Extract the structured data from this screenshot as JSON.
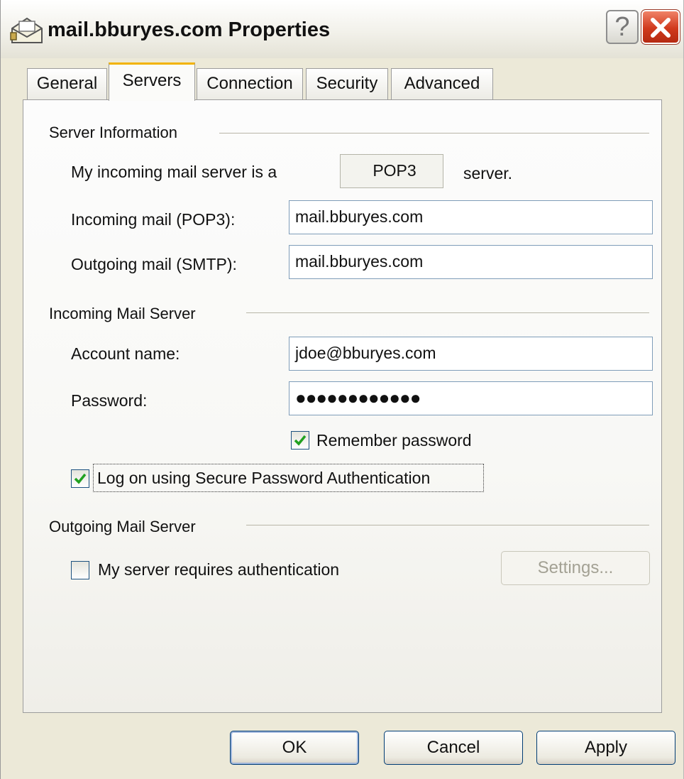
{
  "window": {
    "title": "mail.bburyes.com Properties",
    "icon": "mail-account-icon",
    "help_glyph": "?",
    "close_icon": "close-icon"
  },
  "tabs": [
    {
      "label": "General",
      "active": false
    },
    {
      "label": "Servers",
      "active": true
    },
    {
      "label": "Connection",
      "active": false
    },
    {
      "label": "Security",
      "active": false
    },
    {
      "label": "Advanced",
      "active": false
    }
  ],
  "server_info": {
    "group_label": "Server Information",
    "incoming_type_label_pre": "My incoming mail server is a",
    "incoming_type_value": "POP3",
    "incoming_type_label_post": "server.",
    "incoming_label": "Incoming mail (POP3):",
    "incoming_value": "mail.bburyes.com",
    "outgoing_label": "Outgoing mail (SMTP):",
    "outgoing_value": "mail.bburyes.com"
  },
  "incoming_server": {
    "group_label": "Incoming Mail Server",
    "account_label": "Account name:",
    "account_value": "jdoe@bburyes.com",
    "password_label": "Password:",
    "password_value": "●●●●●●●●●●●●",
    "remember_label": "Remember password",
    "remember_checked": true,
    "spa_label": "Log on using Secure Password Authentication",
    "spa_checked": true
  },
  "outgoing_server": {
    "group_label": "Outgoing Mail Server",
    "auth_label": "My server requires authentication",
    "auth_checked": false,
    "settings_label": "Settings..."
  },
  "buttons": {
    "ok": "OK",
    "cancel": "Cancel",
    "apply": "Apply"
  },
  "colors": {
    "dialog_bg": "#ece9d8",
    "active_tab_accent": "#f2b300",
    "check_mark": "#21a121",
    "close_button": "#d0391c"
  }
}
